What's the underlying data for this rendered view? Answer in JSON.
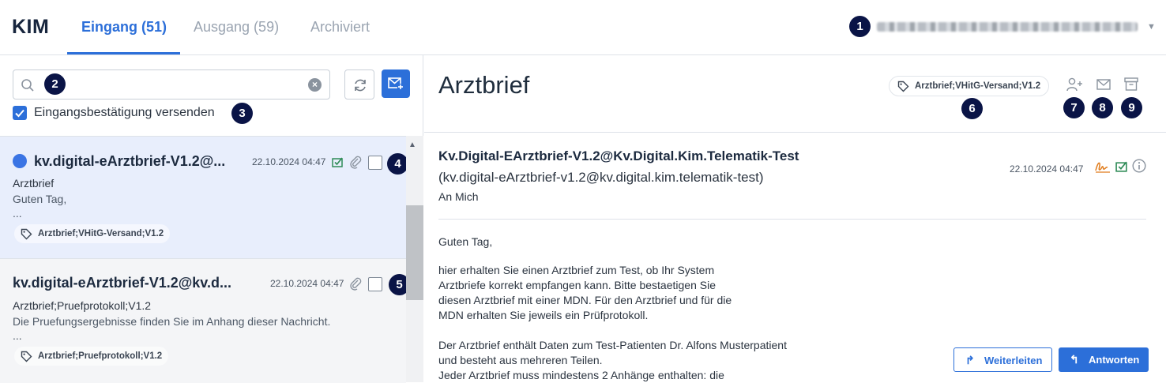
{
  "app": {
    "logo": "KIM"
  },
  "tabs": [
    {
      "label": "Eingang (51)",
      "active": true
    },
    {
      "label": "Ausgang (59)",
      "active": false
    },
    {
      "label": "Archiviert",
      "active": false
    }
  ],
  "annotations": [
    "1",
    "2",
    "3",
    "4",
    "5",
    "6",
    "7",
    "8",
    "9"
  ],
  "search": {
    "value": "",
    "placeholder": ""
  },
  "ack": {
    "label": "Eingangsbestätigung versenden",
    "checked": true
  },
  "messages": [
    {
      "sender": "kv.digital-eArztbrief-V1.2@...",
      "date": "22.10.2024 04:47",
      "subject": "Arztbrief",
      "preview": "Guten Tag,",
      "ellipsis": "...",
      "tag": "Arztbrief;VHitG-Versand;V1.2",
      "unread": true,
      "selected": true
    },
    {
      "sender": "kv.digital-eArztbrief-V1.2@kv.d...",
      "date": "22.10.2024 04:47",
      "subject": "Arztbrief;Pruefprotokoll;V1.2",
      "preview": "Die Pruefungsergebnisse finden Sie im Anhang dieser Nachricht.",
      "ellipsis": "...",
      "tag": "Arztbrief;Pruefprotokoll;V1.2",
      "unread": false,
      "selected": false
    }
  ],
  "detail": {
    "title": "Arztbrief",
    "tag": "Arztbrief;VHitG-Versand;V1.2",
    "from_name": "Kv.Digital-EArztbrief-V1.2@Kv.Digital.Kim.Telematik-Test",
    "from_address": "(kv.digital-eArztbrief-v1.2@kv.digital.kim.telematik-test)",
    "to": "An Mich",
    "date": "22.10.2024 04:47",
    "body": [
      "Guten Tag,",
      "",
      "hier erhalten Sie einen Arztbrief zum Test, ob Ihr System",
      "Arztbriefe korrekt empfangen kann. Bitte bestaetigen Sie",
      "diesen Arztbrief mit einer MDN. Für den Arztbrief und für die",
      "MDN erhalten Sie jeweils ein Prüfprotokoll.",
      "",
      "Der Arztbrief enthält Daten zum Test-Patienten Dr. Alfons Musterpatient",
      "und besteht aus mehreren Teilen.",
      "Jeder Arztbrief muss mindestens 2 Anhänge enthalten: die"
    ],
    "forward_label": "Weiterleiten",
    "reply_label": "Antworten"
  },
  "colors": {
    "accent": "#2c6fd9",
    "badge": "#0a1446",
    "selected_row": "#e8eefc",
    "verified_green": "#2e8b57",
    "signature_orange": "#e07b1a"
  },
  "icons": [
    "search-icon",
    "clear-icon",
    "refresh-icon",
    "compose-icon",
    "tag-icon",
    "verified-icon",
    "attachment-icon",
    "add-contact-icon",
    "mail-icon",
    "archive-icon",
    "signature-icon",
    "info-icon",
    "forward-icon",
    "reply-icon"
  ]
}
